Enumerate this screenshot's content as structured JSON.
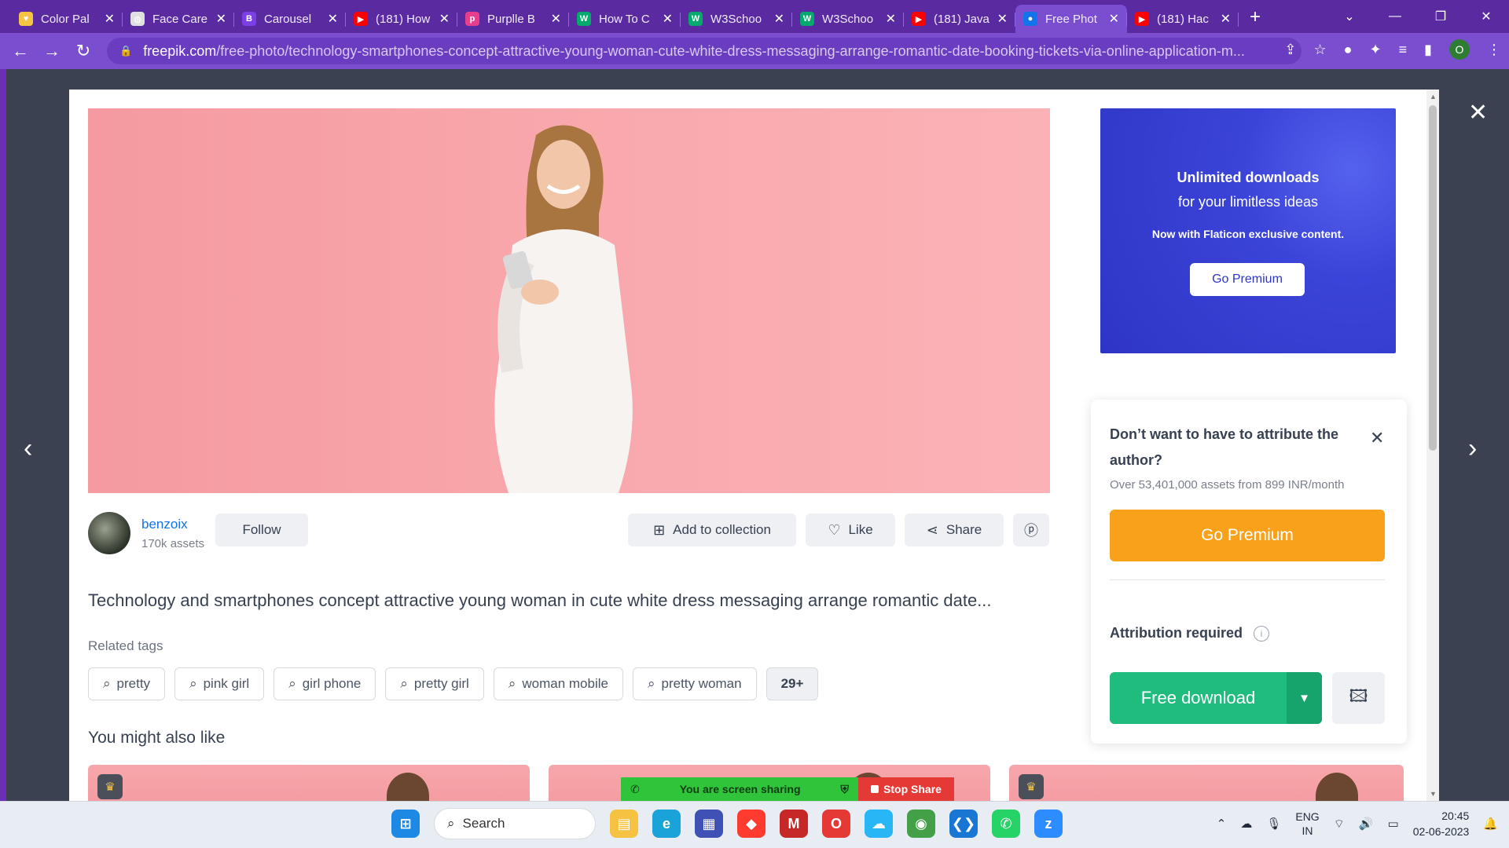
{
  "browser": {
    "tabs": [
      {
        "title": "Color Pal",
        "favicon_color": "#f6c343",
        "glyph": "♥"
      },
      {
        "title": "Face Care",
        "favicon_color": "#e0e0e0",
        "glyph": "◍"
      },
      {
        "title": "Carousel",
        "favicon_color": "#7b3fe4",
        "glyph": "B"
      },
      {
        "title": "(181) How",
        "favicon_color": "#ff0000",
        "glyph": "▶"
      },
      {
        "title": "Purplle B",
        "favicon_color": "#e83e8c",
        "glyph": "p"
      },
      {
        "title": "How To C",
        "favicon_color": "#04aa6d",
        "glyph": "W"
      },
      {
        "title": "W3Schoo",
        "favicon_color": "#04aa6d",
        "glyph": "W"
      },
      {
        "title": "W3Schoo",
        "favicon_color": "#04aa6d",
        "glyph": "W"
      },
      {
        "title": "(181) Java",
        "favicon_color": "#ff0000",
        "glyph": "▶"
      },
      {
        "title": "Free Phot",
        "favicon_color": "#1273eb",
        "glyph": "●"
      },
      {
        "title": "(181) Hac",
        "favicon_color": "#ff0000",
        "glyph": "▶"
      }
    ],
    "active_tab_index": 9,
    "url_host": "freepik.com",
    "url_path": "/free-photo/technology-smartphones-concept-attractive-young-woman-cute-white-dress-messaging-arrange-romantic-date-booking-tickets-via-online-application-m...",
    "profile_initial": "O"
  },
  "author": {
    "name": "benzoix",
    "assets": "170k assets",
    "follow_label": "Follow"
  },
  "actions": {
    "add_collection": "Add to collection",
    "like": "Like",
    "share": "Share"
  },
  "description": "Technology and smartphones concept attractive young woman in cute white dress messaging arrange romantic date...",
  "related": {
    "label": "Related tags",
    "tags": [
      "pretty",
      "pink girl",
      "girl phone",
      "pretty girl",
      "woman mobile",
      "pretty woman"
    ],
    "more": "29+"
  },
  "might_like": "You might also like",
  "promo": {
    "line1": "Unlimited downloads",
    "line2": "for your limitless ideas",
    "line3": "Now with Flaticon exclusive content.",
    "button": "Go Premium"
  },
  "download_card": {
    "question": "Don’t want to have to attribute the author?",
    "subtext": "Over 53,401,000 assets from 899 INR/month",
    "premium_button": "Go Premium",
    "attribution": "Attribution required",
    "download_button": "Free download"
  },
  "screen_share": {
    "status": "You are screen sharing",
    "stop": "Stop Share"
  },
  "taskbar": {
    "search_placeholder": "Search",
    "lang_top": "ENG",
    "lang_bottom": "IN",
    "time": "20:45",
    "date": "02-06-2023"
  },
  "colors": {
    "accent_blue": "#1273eb",
    "premium_orange": "#f9a11b",
    "download_green": "#1fbc7d",
    "promo_blue": "#2e35c6"
  }
}
